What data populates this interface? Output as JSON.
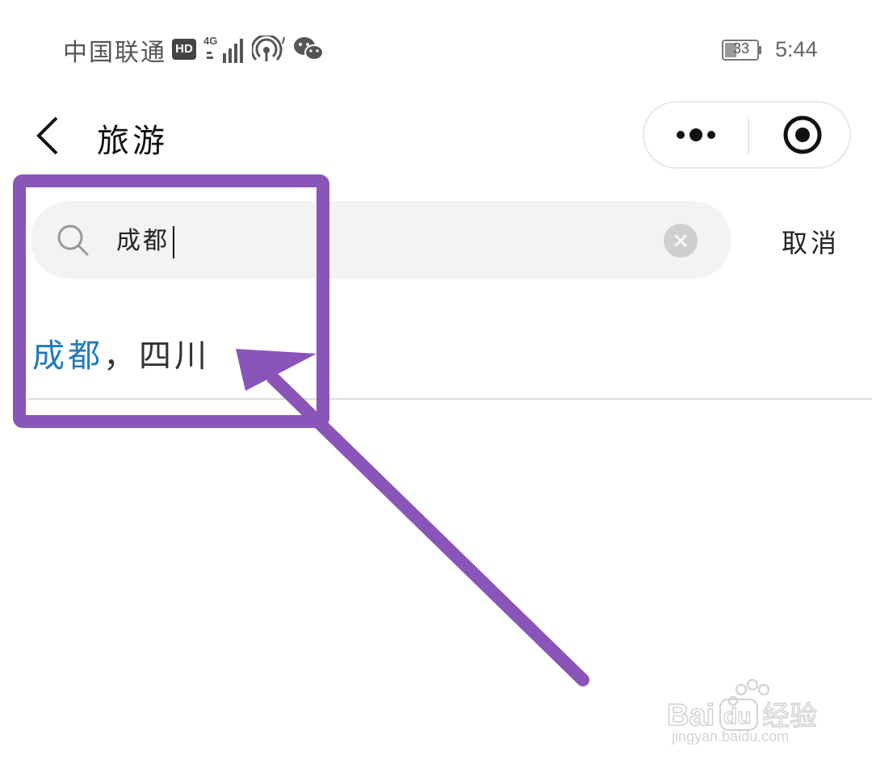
{
  "status_bar": {
    "carrier": "中国联通",
    "hd_badge": "HD",
    "network": "4G",
    "battery": "33",
    "time": "5:44"
  },
  "header": {
    "title": "旅游",
    "back_icon": "chevron-left-icon",
    "more_icon": "more-dots-icon",
    "close_icon": "target-close-icon"
  },
  "search": {
    "value": "成都",
    "cancel_label": "取消",
    "clear_icon": "clear-circle-icon"
  },
  "suggestions": [
    {
      "highlight": "成都",
      "rest": "，四川"
    }
  ],
  "annotation": {
    "color": "#8a55b8"
  },
  "watermark": {
    "brand": "Baidu经验",
    "url": "jingyan.baidu.com"
  }
}
